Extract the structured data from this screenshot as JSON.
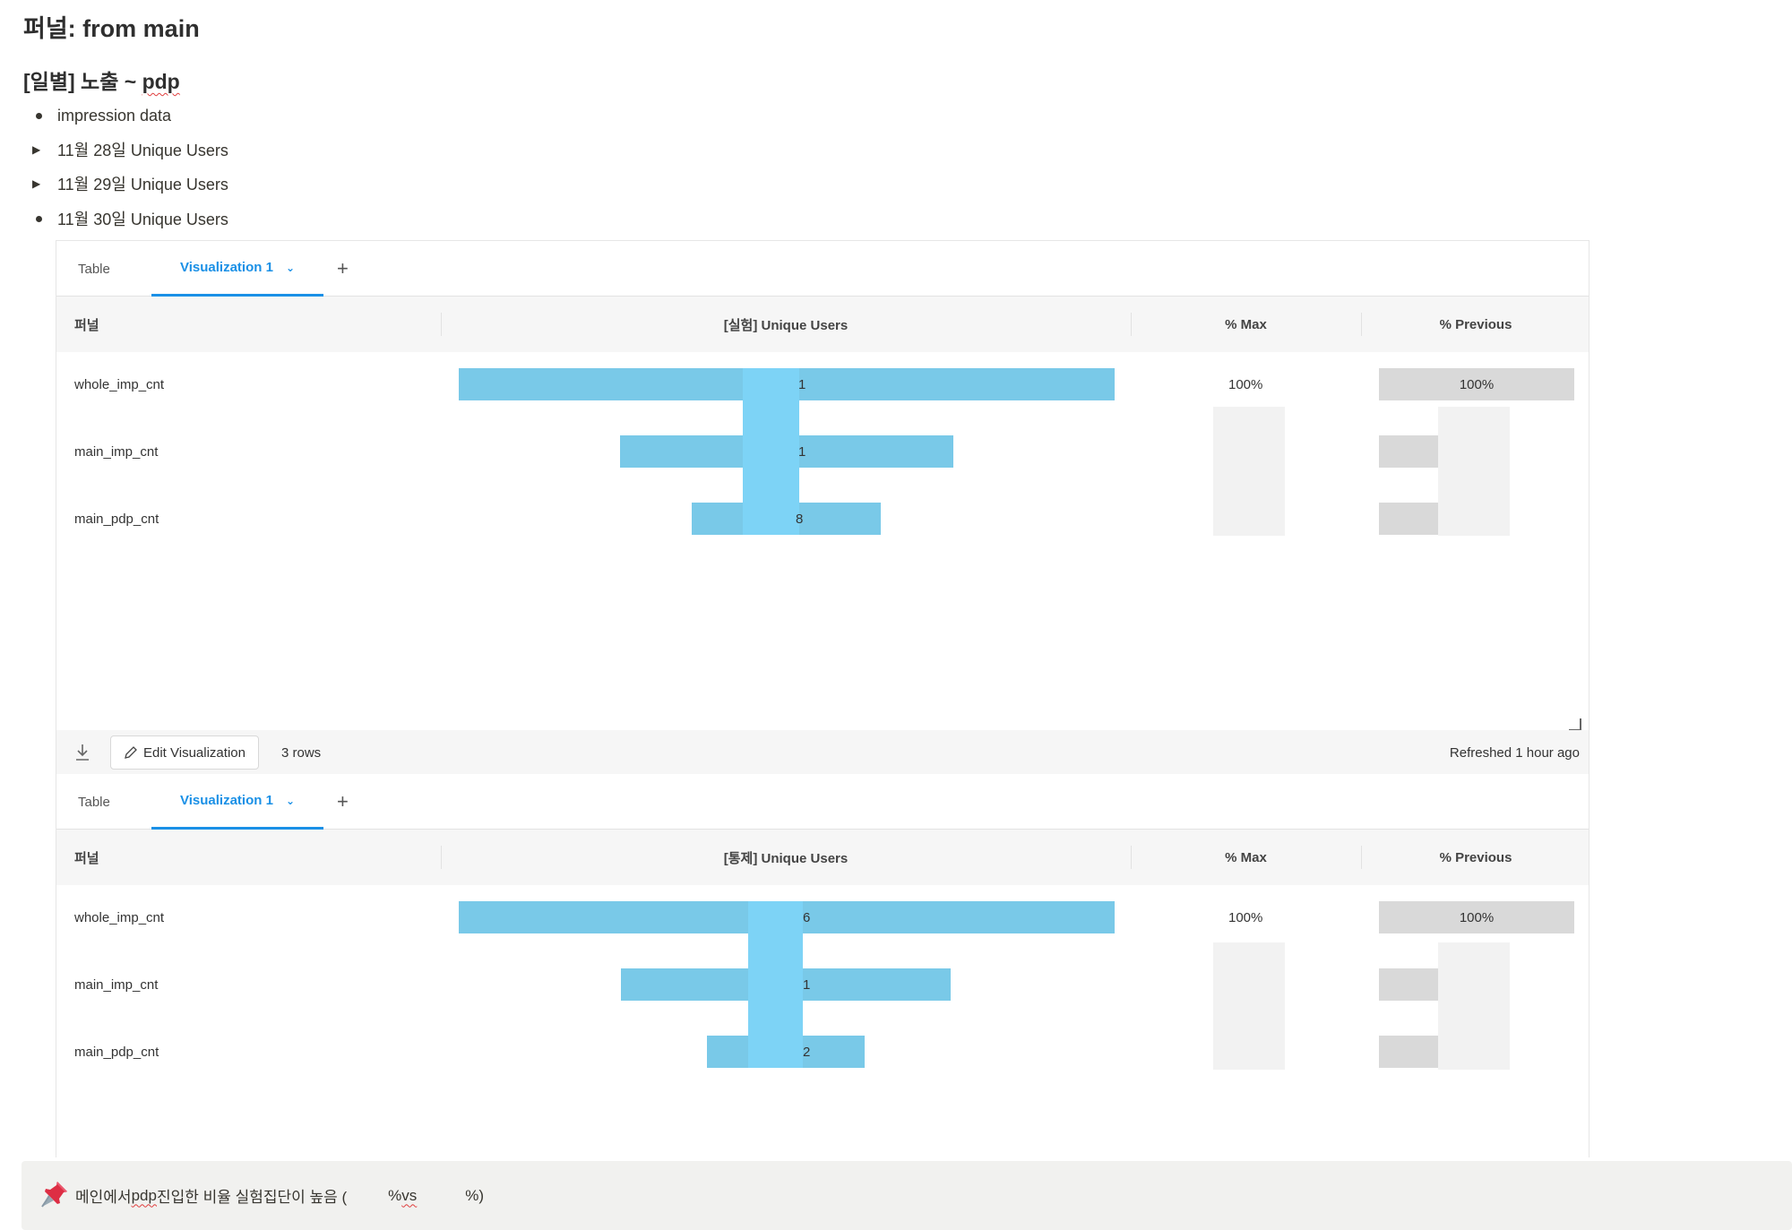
{
  "page": {
    "title": "퍼널: from main",
    "section_title_prefix": "[일별] 노출 ~ ",
    "section_title_word": "pdp"
  },
  "outline": [
    {
      "marker": "bullet",
      "text": "impression data"
    },
    {
      "marker": "toggle",
      "text": "11월 28일 Unique Users"
    },
    {
      "marker": "toggle",
      "text": "11월 29일 Unique Users"
    },
    {
      "marker": "bullet",
      "text": "11월 30일 Unique Users"
    }
  ],
  "visualizations": [
    {
      "tabs": {
        "table": "Table",
        "viz": "Visualization 1",
        "add": "+"
      },
      "columns": {
        "funnel": "퍼널",
        "users": "[실험] Unique Users",
        "pct_max": "% Max",
        "pct_prev": "% Previous"
      },
      "rows": [
        {
          "label": "whole_imp_cnt",
          "value": "1",
          "pct_max": "100%",
          "pct_prev": "100%",
          "width_frac": 1.0
        },
        {
          "label": "main_imp_cnt",
          "value": "1",
          "pct_max": "",
          "pct_prev": "",
          "width_frac": 0.508
        },
        {
          "label": "main_pdp_cnt",
          "value": "8",
          "pct_max": "",
          "pct_prev": "",
          "width_frac": 0.288
        }
      ],
      "footer": {
        "edit_label": "Edit Visualization",
        "rows_label": "3 rows",
        "refreshed_label": "Refreshed 1 hour ago"
      }
    },
    {
      "tabs": {
        "table": "Table",
        "viz": "Visualization 1",
        "add": "+"
      },
      "columns": {
        "funnel": "퍼널",
        "users": "[통제] Unique Users",
        "pct_max": "% Max",
        "pct_prev": "% Previous"
      },
      "rows": [
        {
          "label": "whole_imp_cnt",
          "value": "6",
          "pct_max": "100%",
          "pct_prev": "100%",
          "width_frac": 1.0
        },
        {
          "label": "main_imp_cnt",
          "value": "1",
          "pct_max": "",
          "pct_prev": "",
          "width_frac": 0.503
        },
        {
          "label": "main_pdp_cnt",
          "value": "2",
          "pct_max": "",
          "pct_prev": "",
          "width_frac": 0.241
        }
      ]
    }
  ],
  "callout": {
    "icon": "pushpin-icon",
    "text_a": "메인에서 ",
    "text_word": "pdp",
    "text_b": " 진입한 비율 실험집단이 높음 (",
    "text_c": "% ",
    "text_vs": "vs",
    "text_d": "%)"
  },
  "colors": {
    "bar": "#79c9e8",
    "bar_overlay": "#7dd3f6",
    "accent": "#1a90e6",
    "prev_bar": "#d9d9d9",
    "grey_block": "#f2f2f2"
  }
}
